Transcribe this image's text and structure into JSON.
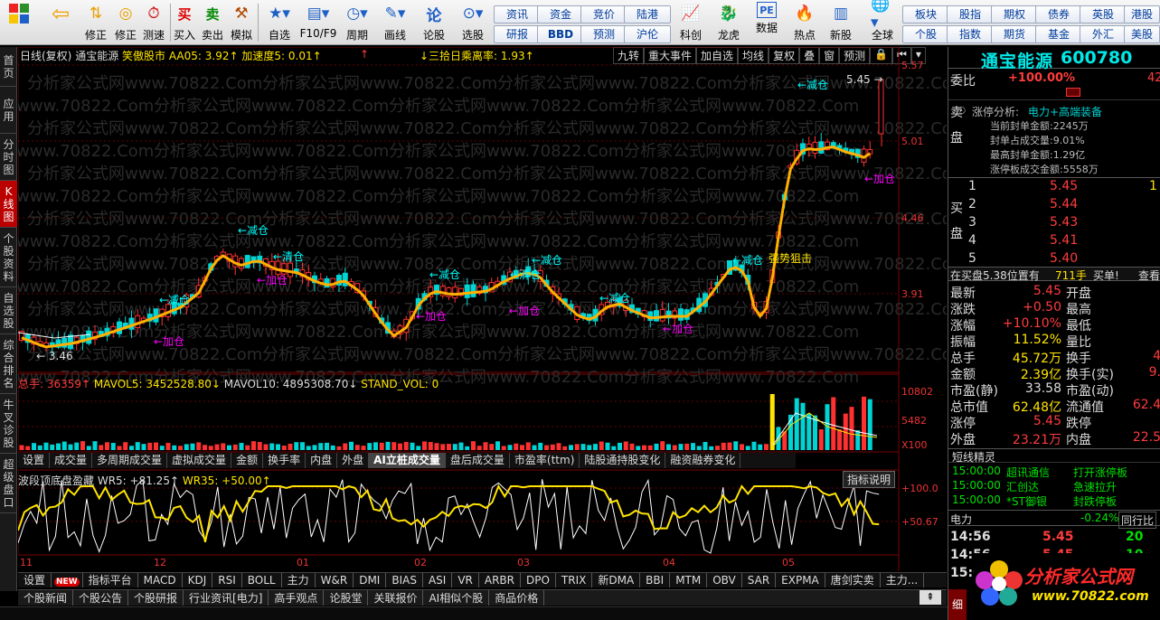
{
  "toolbar": {
    "buttons": [
      {
        "label": "",
        "icon": "app-grid-icon"
      },
      {
        "label": "",
        "icon": "back-arrow-icon"
      },
      {
        "label": "修正",
        "icon": "correct-icon"
      },
      {
        "label": "测速",
        "icon": "speed-test-icon"
      },
      {
        "label": "买入",
        "icon": "buy-icon"
      },
      {
        "label": "卖出",
        "icon": "sell-icon"
      },
      {
        "label": "模拟",
        "icon": "simulate-icon"
      },
      {
        "label": "自选",
        "icon": "favorites-icon"
      },
      {
        "label": "F10/F9",
        "icon": "f10-icon"
      },
      {
        "label": "周期",
        "icon": "period-icon"
      },
      {
        "label": "画线",
        "icon": "draw-line-icon"
      },
      {
        "label": "论股",
        "icon": "discuss-icon"
      },
      {
        "label": "选股",
        "icon": "stock-select-icon"
      }
    ],
    "small_buttons": [
      [
        "资讯",
        "研报"
      ],
      [
        "资金",
        "BBD"
      ],
      [
        "竞价",
        "预测"
      ],
      [
        "陆港",
        "沪伦"
      ]
    ],
    "buttons2": [
      {
        "label": "科创",
        "icon": "star-market-icon"
      },
      {
        "label": "龙虎",
        "icon": "dragon-tiger-icon"
      },
      {
        "label": "数据",
        "icon": "pe-data-icon"
      },
      {
        "label": "热点",
        "icon": "hot-fire-icon"
      },
      {
        "label": "新股",
        "icon": "new-stock-icon"
      },
      {
        "label": "全球",
        "icon": "globe-icon"
      }
    ],
    "small_buttons2": [
      [
        "板块",
        "个股"
      ],
      [
        "股指",
        "指数"
      ],
      [
        "期权",
        "期货"
      ],
      [
        "债券",
        "基金"
      ],
      [
        "英股",
        "外汇"
      ],
      [
        "港股",
        "美股"
      ]
    ]
  },
  "leftnav": [
    "首页",
    "应用",
    "分时图",
    "K线图",
    "个股资料",
    "自选股",
    "综合排名",
    "牛叉诊股",
    "超级盘口"
  ],
  "kline": {
    "info": {
      "period": "日线(复权)",
      "stock": "通宝能源",
      "concept": "笑傲股市",
      "aa": "AA05: 3.92↑",
      "speed": "加速度5: 0.01↑",
      "arrow1": "↑",
      "ratio": "↓三拾日乘离率: 1.93↑"
    },
    "buttons": [
      "九转",
      "重大事件",
      "加自选",
      "均线",
      "复权",
      "叠",
      "窗",
      "预测"
    ],
    "price_ticks": [
      "5.57",
      "5.01",
      "4.46",
      "3.91"
    ],
    "max_label": "5.45",
    "min_label": "3.46",
    "annotations": [
      "减仓",
      "减仓",
      "清仓",
      "减仓",
      "清仓",
      "减仓",
      "减仓",
      "减仓",
      "减仓",
      "减仓",
      "加仓",
      "加仓",
      "加仓",
      "加仓",
      "加仓",
      "加仓",
      "强势狙击"
    ],
    "watermark": "分析家公式网www.70822.Com"
  },
  "volume": {
    "info_total": "总手: 36359↑",
    "info_mavol5": "MAVOL5: 3452528.80↓",
    "info_mavol10": "MAVOL10: 4895308.70↓",
    "info_stand": "STAND_VOL: 0",
    "ticks": [
      "10802",
      "5482",
      "X100"
    ],
    "tabs": [
      "设置",
      "成交量",
      "多周期成交量",
      "虚拟成交量",
      "金额",
      "换手率",
      "内盘",
      "外盘",
      "AI立桩成交量",
      "盘后成交量",
      "市盈率(ttm)",
      "陆股通持股变化",
      "融资融券变化"
    ],
    "selected_tab": "AI立桩成交量"
  },
  "oscillator": {
    "title": "波段顶底盘盈藏",
    "wr5": "WR5: +81.25↑",
    "wr35": "WR35: +50.00↑",
    "help": "指标说明",
    "ticks": [
      "+100.0",
      "+50.67"
    ]
  },
  "xaxis": [
    "11",
    "12",
    "01",
    "02",
    "03",
    "04",
    "05"
  ],
  "indicator_bar": [
    "设置",
    "NEW",
    "指标平台",
    "MACD",
    "KDJ",
    "RSI",
    "BOLL",
    "主力",
    "W&R",
    "DMI",
    "BIAS",
    "ASI",
    "VR",
    "ARBR",
    "DPO",
    "TRIX",
    "新DMA",
    "BBI",
    "MTM",
    "OBV",
    "SAR",
    "EXPMA",
    "唐剑实卖",
    "主力..."
  ],
  "news_bar": [
    "个股新闻",
    "个股公告",
    "个股研报",
    "行业资讯[电力]",
    "高手观点",
    "论股堂",
    "关联报价",
    "AI相似个股",
    "商品价格"
  ],
  "right": {
    "name": "通宝能源",
    "code": "600780",
    "weibi_label": "委比",
    "weibi": "+100.00%",
    "weicha": "42",
    "limit_title": "涨停分析:",
    "limit_tags": "电力+高端装备",
    "limit_lines": [
      "当前封单金额:2245万",
      "封单占成交量:9.01%",
      "最高封单金额:1.29亿",
      "涨停板成交金额:5558万"
    ],
    "sell_label": "卖盘",
    "buy_label": "买盘",
    "bids": [
      {
        "lvl": "1",
        "price": "5.45",
        "vol": "1"
      },
      {
        "lvl": "2",
        "price": "5.44",
        "vol": ""
      },
      {
        "lvl": "3",
        "price": "5.43",
        "vol": ""
      },
      {
        "lvl": "4",
        "price": "5.41",
        "vol": ""
      },
      {
        "lvl": "5",
        "price": "5.40",
        "vol": ""
      }
    ],
    "inbuy": "在买盘5.38位置有",
    "inbuy_vol": "711手",
    "inbuy_act": "买单!",
    "inbuy_view": "查看",
    "quote": [
      {
        "l": "最新",
        "v": "5.45",
        "c": "red",
        "r": "开盘",
        "rv": ""
      },
      {
        "l": "涨跌",
        "v": "+0.50",
        "c": "red",
        "r": "最高",
        "rv": ""
      },
      {
        "l": "涨幅",
        "v": "+10.10%",
        "c": "red",
        "r": "最低",
        "rv": ""
      },
      {
        "l": "振幅",
        "v": "11.52%",
        "c": "yel",
        "r": "量比",
        "rv": ""
      },
      {
        "l": "总手",
        "v": "45.72万",
        "c": "yel",
        "r": "换手",
        "rv": "4"
      },
      {
        "l": "金额",
        "v": "2.39亿",
        "c": "yel",
        "r": "换手(实)",
        "rv": "9."
      },
      {
        "l": "市盈(静)",
        "v": "33.58",
        "c": "wht",
        "r": "市盈(动)",
        "rv": ""
      },
      {
        "l": "总市值",
        "v": "62.48亿",
        "c": "yel",
        "r": "流通值",
        "rv": "62.4"
      },
      {
        "l": "涨停",
        "v": "5.45",
        "c": "red",
        "r": "跌停",
        "rv": ""
      },
      {
        "l": "外盘",
        "v": "23.21万",
        "c": "red",
        "r": "内盘",
        "rv": "22.5"
      }
    ],
    "elite_title": "短线精灵",
    "elite": [
      {
        "t": "15:00:00",
        "n": "超讯通信",
        "a": "打开涨停板"
      },
      {
        "t": "15:00:00",
        "n": "汇创达",
        "a": "急速拉升"
      },
      {
        "t": "15:00:00",
        "n": "*ST御银",
        "a": "封跌停板"
      }
    ],
    "sector": "电力",
    "sector_chg": "-0.24%",
    "sector_more": "同行比",
    "ticks": [
      {
        "t": "14:56",
        "p": "5.45",
        "v": "20"
      },
      {
        "t": "14:56",
        "p": "5.45",
        "v": "10"
      },
      {
        "t": "15:0",
        "p": "",
        "v": ""
      }
    ],
    "detail_tab": "细",
    "logo": "分析家公式网",
    "logo_url": "www.70822.com"
  }
}
